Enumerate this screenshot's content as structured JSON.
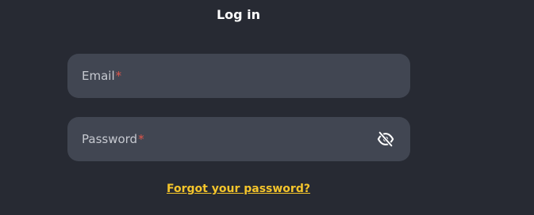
{
  "page": {
    "title": "Log in"
  },
  "email": {
    "label": "Email",
    "required_mark": "*",
    "value": ""
  },
  "password": {
    "label": "Password",
    "required_mark": "*",
    "value": "",
    "toggle_icon": "eye-slash-icon"
  },
  "forgot_link": {
    "label": "Forgot your password?"
  },
  "colors": {
    "background": "#272a33",
    "field_background": "#414652",
    "accent": "#f5c52b",
    "required": "#e0554a"
  }
}
